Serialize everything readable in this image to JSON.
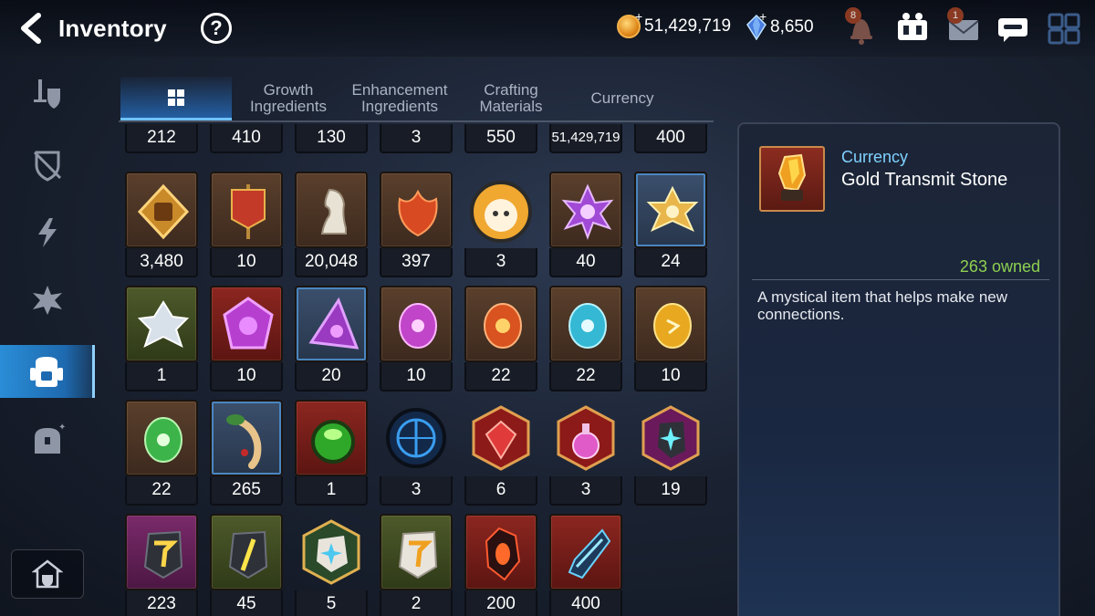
{
  "header": {
    "title": "Inventory",
    "help_label": "?",
    "gold": "51,429,719",
    "crystals": "8,650",
    "notifications_badge": "8",
    "mail_badge": "1"
  },
  "sidebar": {
    "items": [
      {
        "icon": "equipment-icon"
      },
      {
        "icon": "artifact-icon"
      },
      {
        "icon": "lightning-icon"
      },
      {
        "icon": "skill-icon"
      },
      {
        "icon": "backpack-icon",
        "active": true
      },
      {
        "icon": "chest-icon"
      }
    ],
    "home_icon": "home-icon"
  },
  "tabs": [
    {
      "label": "",
      "icon": "grid-icon",
      "active": true
    },
    {
      "label": "Growth\nIngredients"
    },
    {
      "label": "Enhancement\nIngredients"
    },
    {
      "label": "Crafting\nMaterials"
    },
    {
      "label": "Currency"
    }
  ],
  "grid": {
    "row0": [
      "212",
      "410",
      "130",
      "3",
      "550",
      "51,429,719",
      "400"
    ],
    "rows": [
      [
        "3,480",
        "10",
        "20,048",
        "397",
        "3",
        "40",
        "24"
      ],
      [
        "1",
        "10",
        "20",
        "10",
        "22",
        "22",
        "10"
      ],
      [
        "22",
        "265",
        "1",
        "3",
        "6",
        "3",
        "19"
      ],
      [
        "223",
        "45",
        "5",
        "2",
        "200",
        "400"
      ]
    ]
  },
  "detail": {
    "category": "Currency",
    "name": "Gold Transmit Stone",
    "owned": "263 owned",
    "description": "A mystical item that helps make new connections."
  },
  "colors": {
    "accent": "#2a8dd6",
    "owned_green": "#8ed050",
    "category_blue": "#7fd1ff"
  }
}
